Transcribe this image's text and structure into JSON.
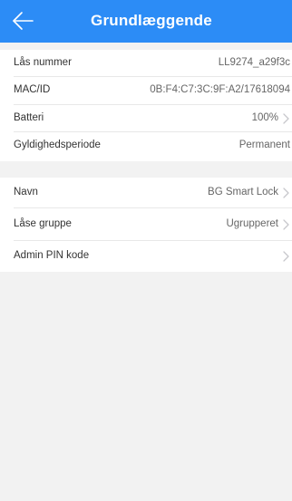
{
  "header": {
    "title": "Grundlæggende"
  },
  "info_section": {
    "rows": [
      {
        "label": "Lås nummer",
        "value": "LL9274_a29f3c"
      },
      {
        "label": "MAC/ID",
        "value": "0B:F4:C7:3C:9F:A2/17618094"
      },
      {
        "label": "Batteri",
        "value": "100%"
      },
      {
        "label": "Gyldighedsperiode",
        "value": "Permanent"
      }
    ]
  },
  "settings_section": {
    "rows": [
      {
        "label": "Navn",
        "value": "BG Smart Lock"
      },
      {
        "label": "Låse gruppe",
        "value": "Ugrupperet"
      },
      {
        "label": "Admin PIN kode",
        "value": ""
      }
    ]
  },
  "colors": {
    "header_bg": "#2c8cf6",
    "page_bg": "#f2f2f2",
    "row_bg": "#ffffff",
    "label_text": "#333333",
    "value_text": "#666666",
    "chevron": "#c7c7cc"
  },
  "icons": {
    "back": "arrow-left-icon",
    "disclosure": "chevron-right-icon"
  }
}
